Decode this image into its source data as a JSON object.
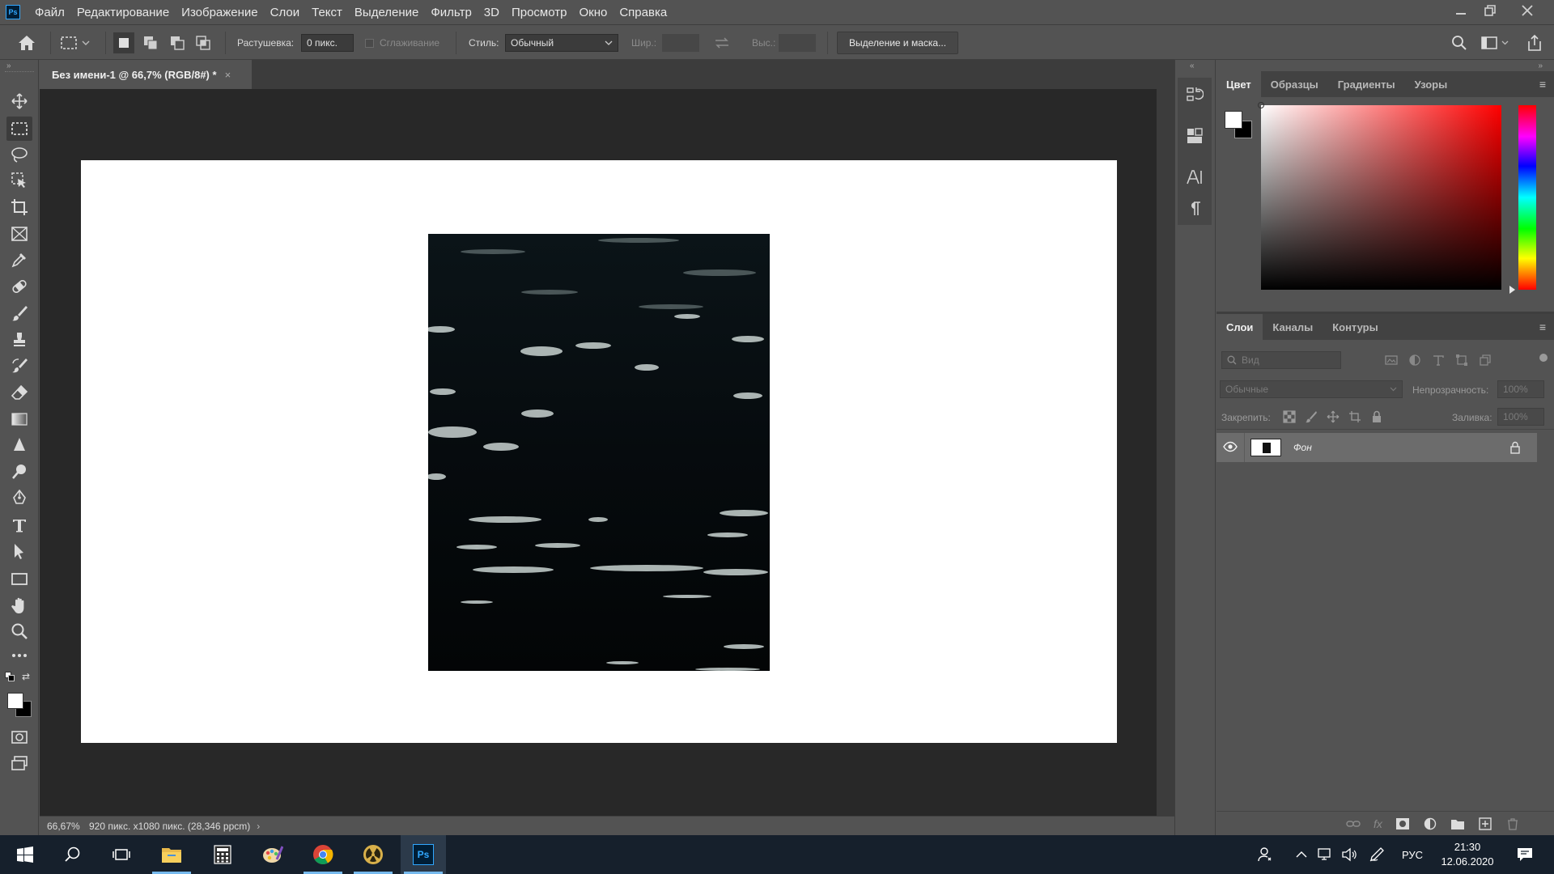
{
  "app": {
    "logo_text": "Ps"
  },
  "menu": [
    "Файл",
    "Редактирование",
    "Изображение",
    "Слои",
    "Текст",
    "Выделение",
    "Фильтр",
    "3D",
    "Просмотр",
    "Окно",
    "Справка"
  ],
  "options": {
    "feather_label": "Растушевка:",
    "feather_value": "0 пикс.",
    "antialias_label": "Сглаживание",
    "style_label": "Стиль:",
    "style_value": "Обычный",
    "width_label": "Шир.:",
    "height_label": "Выс.:",
    "select_mask_button": "Выделение и маска..."
  },
  "document": {
    "tab_title": "Без имени-1 @ 66,7% (RGB/8#) *",
    "close_glyph": "×"
  },
  "status": {
    "zoom": "66,67%",
    "doc_info": "920 пикс. x1080 пикс. (28,346 ppcm)"
  },
  "color_panel": {
    "tabs": [
      "Цвет",
      "Образцы",
      "Градиенты",
      "Узоры"
    ],
    "active_tab": 0
  },
  "layers_panel": {
    "tabs": [
      "Слои",
      "Каналы",
      "Контуры"
    ],
    "active_tab": 0,
    "search_placeholder": "Вид",
    "blend_mode": "Обычные",
    "opacity_label": "Непрозрачность:",
    "opacity_value": "100%",
    "lock_label": "Закрепить:",
    "fill_label": "Заливка:",
    "fill_value": "100%",
    "layers": [
      {
        "name": "Фон",
        "visible": true,
        "locked": true
      }
    ]
  },
  "taskbar": {
    "language": "РУС",
    "time": "21:30",
    "date": "12.06.2020"
  },
  "colors": {
    "accent": "#31a8ff",
    "ui_bg": "#535353",
    "canvas_bg": "#282828",
    "taskbar_bg": "#16202c"
  }
}
